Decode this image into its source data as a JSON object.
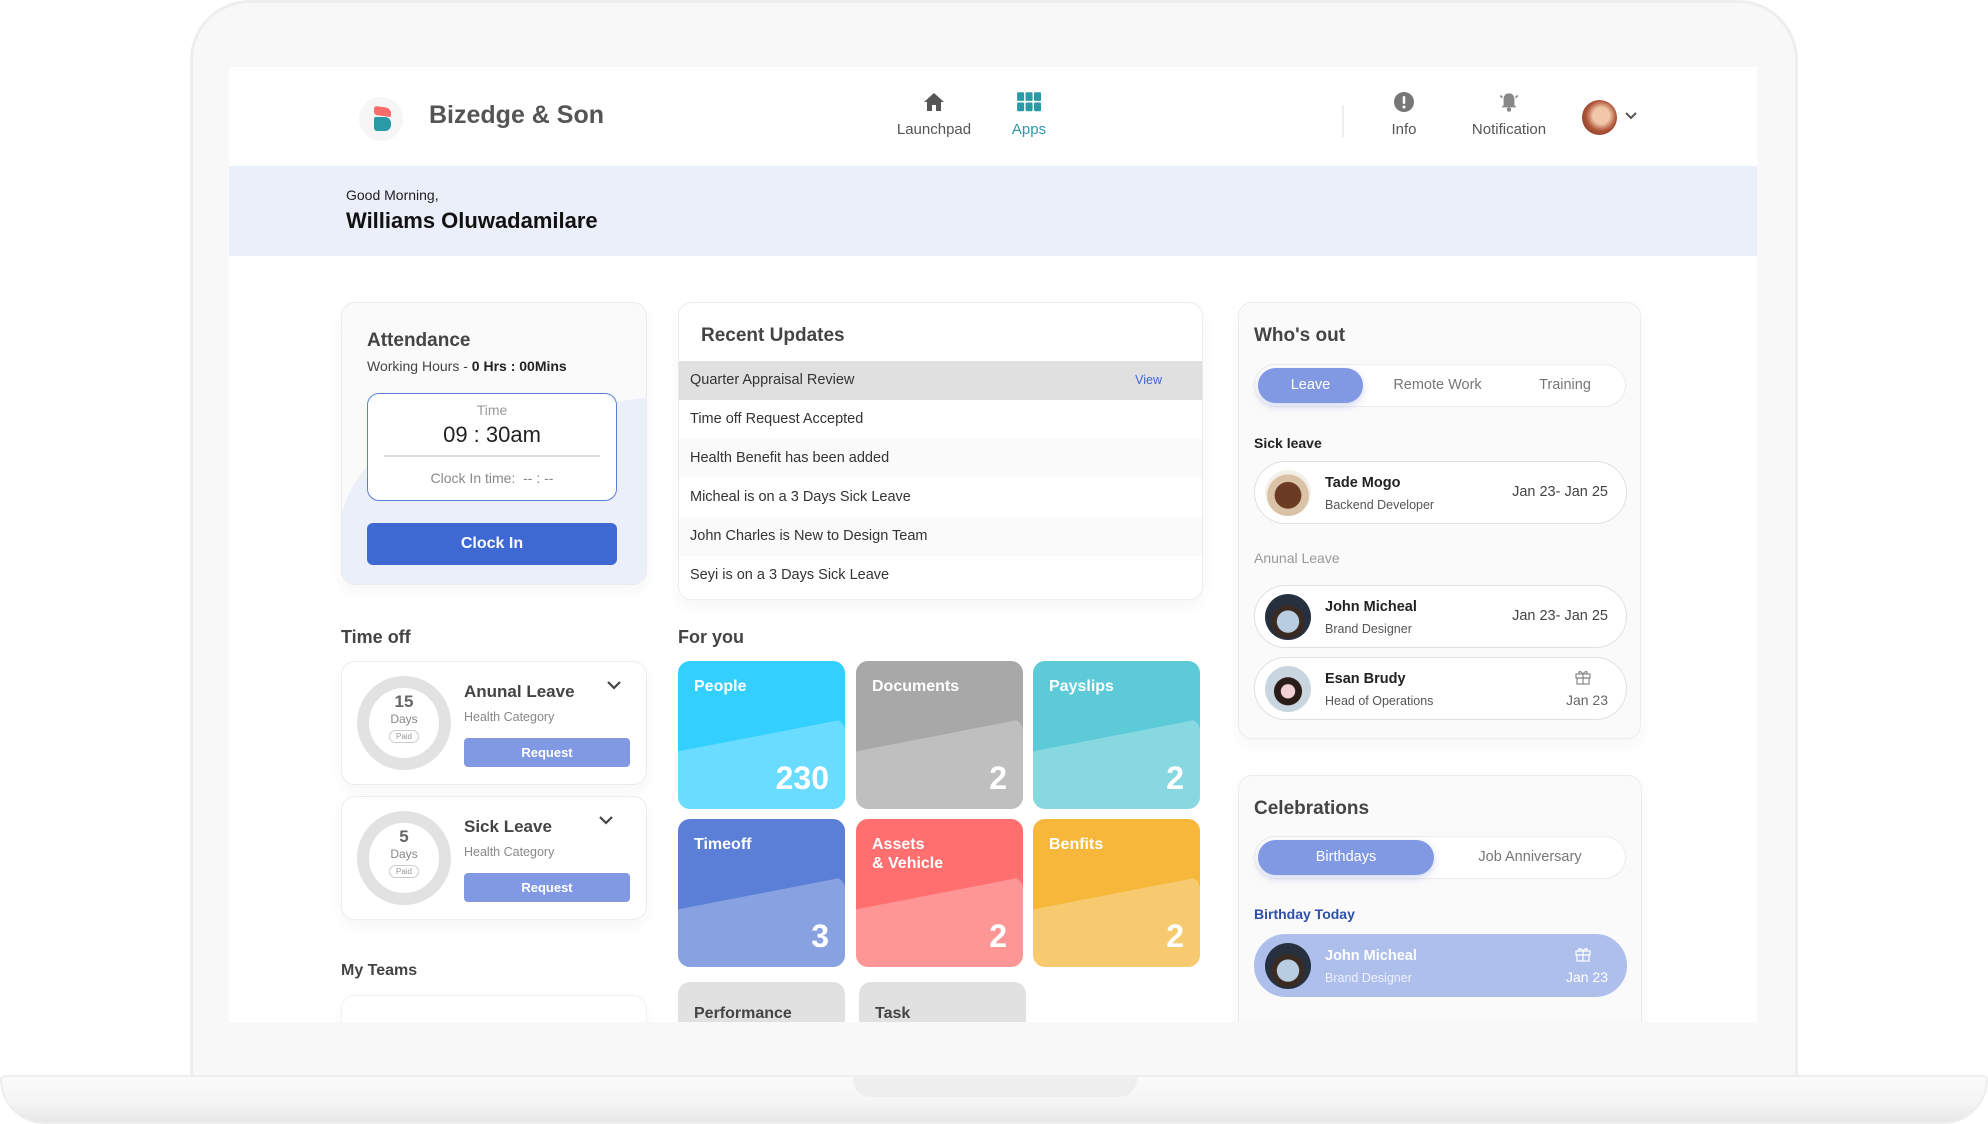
{
  "brand": {
    "name": "Bizedge & Son",
    "logo_icon": "bizedge-logo-icon"
  },
  "nav": {
    "items": [
      {
        "label": "Launchpad",
        "icon": "home-icon",
        "active": false
      },
      {
        "label": "Apps",
        "icon": "apps-grid-icon",
        "active": true
      },
      {
        "label": "Info",
        "icon": "info-icon",
        "active": false
      },
      {
        "label": "Notification",
        "icon": "bell-icon",
        "active": false
      }
    ],
    "accent_color": "#2a9aa6"
  },
  "greeting": {
    "salutation": "Good Morning,",
    "name": "Williams Oluwadamilare"
  },
  "attendance": {
    "title": "Attendance",
    "working_hours_label": "Working Hours - ",
    "working_hours_value": "0 Hrs : 00Mins",
    "time_label": "Time",
    "time_value": "09 : 30am",
    "clock_in_time_label": "Clock In time:",
    "clock_in_time_value": "-- : --",
    "clock_in_button": "Clock In"
  },
  "time_off": {
    "title": "Time off",
    "items": [
      {
        "count": "15",
        "unit": "Days",
        "badge": "Paid",
        "name": "Anunal Leave",
        "category": "Health Category",
        "button": "Request"
      },
      {
        "count": "5",
        "unit": "Days",
        "badge": "Paid",
        "name": "Sick Leave",
        "category": "Health Category",
        "button": "Request"
      }
    ]
  },
  "my_teams": {
    "title": "My Teams"
  },
  "recent_updates": {
    "title": "Recent Updates",
    "view_label": "View",
    "items": [
      "Quarter Appraisal Review",
      "Time off Request Accepted",
      "Health Benefit has been added",
      "Micheal is on a 3 Days Sick Leave",
      "John Charles is New to Design Team",
      "Seyi is on a 3 Days Sick Leave"
    ]
  },
  "for_you": {
    "title": "For you",
    "tiles": [
      {
        "label": "People",
        "count": "230",
        "color": "#33cfff"
      },
      {
        "label": "Documents",
        "count": "2",
        "color": "#a8a8a8"
      },
      {
        "label": "Payslips",
        "count": "2",
        "color": "#5ccad7"
      },
      {
        "label": "Timeoff",
        "count": "3",
        "color": "#5b7fd6"
      },
      {
        "label": "Assets\n& Vehicle",
        "count": "2",
        "color": "#ff6f6f"
      },
      {
        "label": "Benfits",
        "count": "2",
        "color": "#f6b73a"
      },
      {
        "label": "Performance",
        "count": ""
      },
      {
        "label": "Task",
        "count": ""
      }
    ]
  },
  "whos_out": {
    "title": "Who's out",
    "tabs": [
      "Leave",
      "Remote Work",
      "Training"
    ],
    "active_tab": "Leave",
    "sick_leave_heading": "Sick leave",
    "sick_leave": [
      {
        "name": "Tade Mogo",
        "role": "Backend Developer",
        "dates": "Jan 23- Jan 25"
      }
    ],
    "annual_leave_heading": "Anunal Leave",
    "annual_leave": [
      {
        "name": "John Micheal",
        "role": "Brand Designer",
        "dates": "Jan 23- Jan 25"
      },
      {
        "name": "Esan Brudy",
        "role": "Head of Operations",
        "date": "Jan 23",
        "icon": "gift-icon"
      }
    ]
  },
  "celebrations": {
    "title": "Celebrations",
    "tabs": [
      "Birthdays",
      "Job Anniversary"
    ],
    "active_tab": "Birthdays",
    "today_heading": "Birthday Today",
    "items": [
      {
        "name": "John Micheal",
        "role": "Brand Designer",
        "date": "Jan 23",
        "icon": "gift-icon"
      }
    ]
  }
}
